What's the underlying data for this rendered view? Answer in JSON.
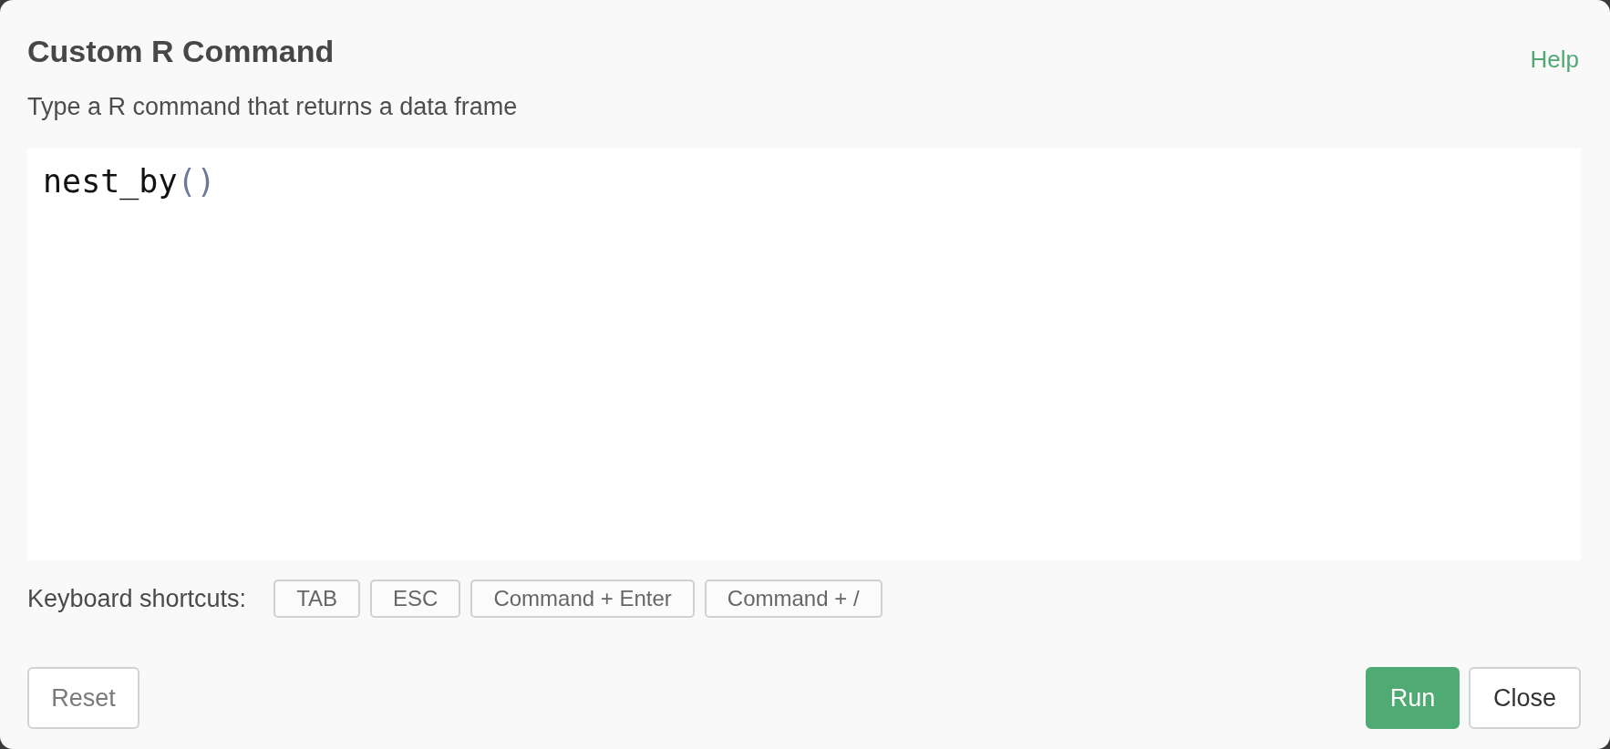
{
  "dialog": {
    "title": "Custom R Command",
    "help_link": "Help",
    "description": "Type a R command that returns a data frame"
  },
  "editor": {
    "lines": [
      [
        {
          "text": "nest_by",
          "kind": "identifier"
        },
        {
          "text": "()",
          "kind": "bracket"
        }
      ]
    ]
  },
  "shortcuts": {
    "label": "Keyboard shortcuts:",
    "keys": [
      "TAB",
      "ESC",
      "Command + Enter",
      "Command + /"
    ]
  },
  "footer": {
    "left_buttons": [
      {
        "label": "Reset",
        "kind": "default",
        "disabled": true
      }
    ],
    "right_buttons": [
      {
        "label": "Run",
        "kind": "primary",
        "disabled": false
      },
      {
        "label": "Close",
        "kind": "default",
        "disabled": false
      }
    ]
  }
}
